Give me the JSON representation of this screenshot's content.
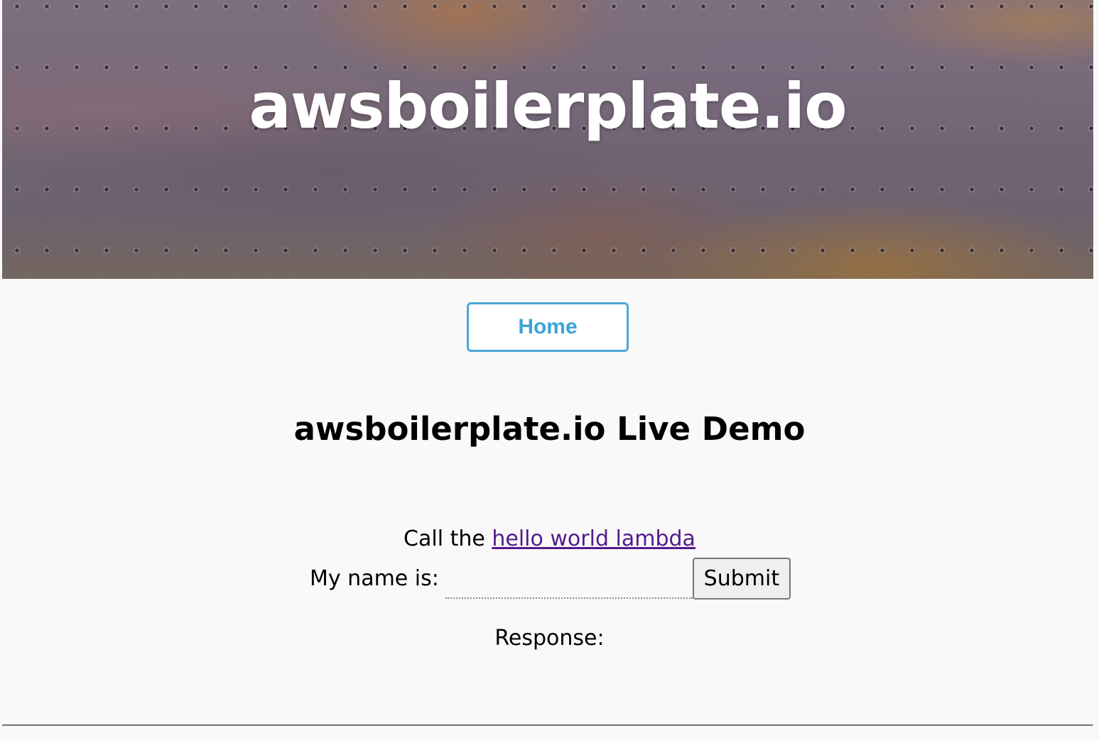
{
  "banner": {
    "title": "awsboilerplate.io"
  },
  "nav": {
    "home_label": "Home"
  },
  "main": {
    "heading": "awsboilerplate.io Live Demo",
    "call_prefix": "Call the ",
    "call_link": "hello world lambda",
    "name_label": "My name is:",
    "name_value": "",
    "submit_label": "Submit",
    "response_label": "Response:"
  },
  "colors": {
    "accent": "#3ba4d8",
    "link_visited": "#551a8b",
    "background": "#f9f9f9"
  }
}
